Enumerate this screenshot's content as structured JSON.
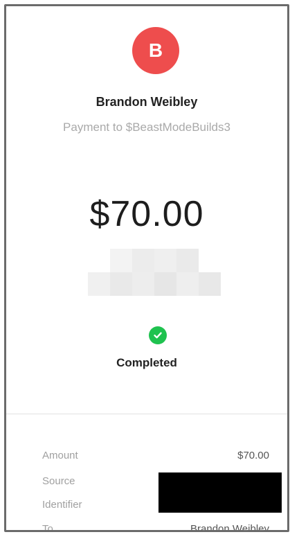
{
  "profile": {
    "initial": "B",
    "name": "Brandon Weibley",
    "subtitle": "Payment to $BeastModeBuilds3"
  },
  "payment": {
    "amount": "$70.00",
    "status": "Completed"
  },
  "details": {
    "amount_label": "Amount",
    "amount_value": "$70.00",
    "source_label": "Source",
    "identifier_label": "Identifier",
    "to_label": "To",
    "to_value": "Brandon Weibley"
  },
  "colors": {
    "avatar": "#ee4d4d",
    "status_success": "#1fc24f"
  },
  "icons": {
    "status": "check-circle-icon"
  }
}
